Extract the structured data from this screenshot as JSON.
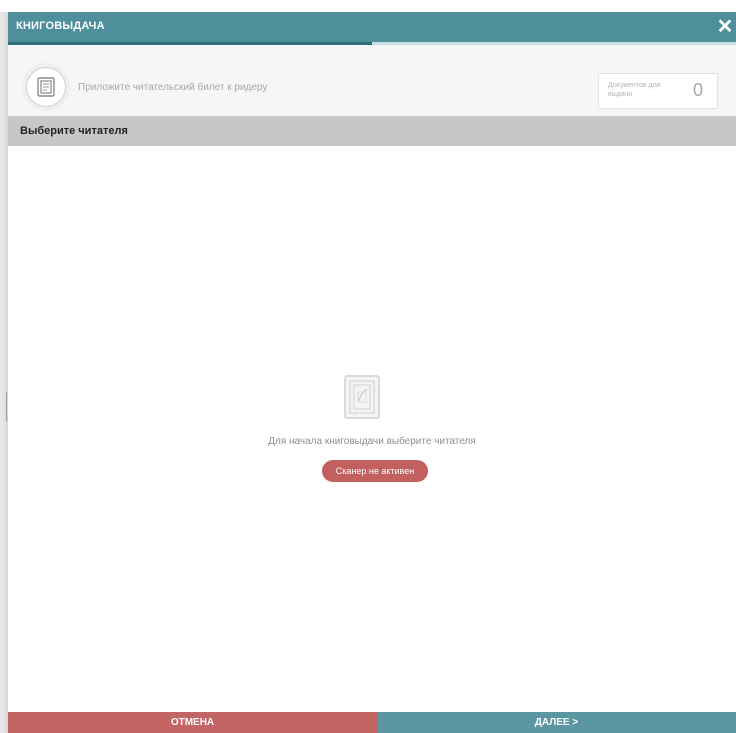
{
  "window": {
    "title": "КНИГОВЫДАЧА",
    "close_icon": "close-icon",
    "progress": 0.5
  },
  "info": {
    "ticket_icon": "reader-card-icon",
    "hint": "Приложите читательский билет к ридеру",
    "counter_label": "Документов для выдачи",
    "counter_value": "0"
  },
  "section": {
    "title": "Выберите читателя"
  },
  "main": {
    "empty_icon": "scanner-icon",
    "empty_text": "Для начала книговыдачи выберите читателя",
    "scanner_button": "Сканер не активен"
  },
  "footer": {
    "cancel_label": "ОТМЕНА",
    "next_label": "ДАЛЕЕ >"
  },
  "colors": {
    "titlebar": "#4d8f9b",
    "cancel": "#c46565",
    "next": "#5b97a2",
    "scanner_button": "#c25f5f",
    "section_header": "#c7c7c7"
  }
}
